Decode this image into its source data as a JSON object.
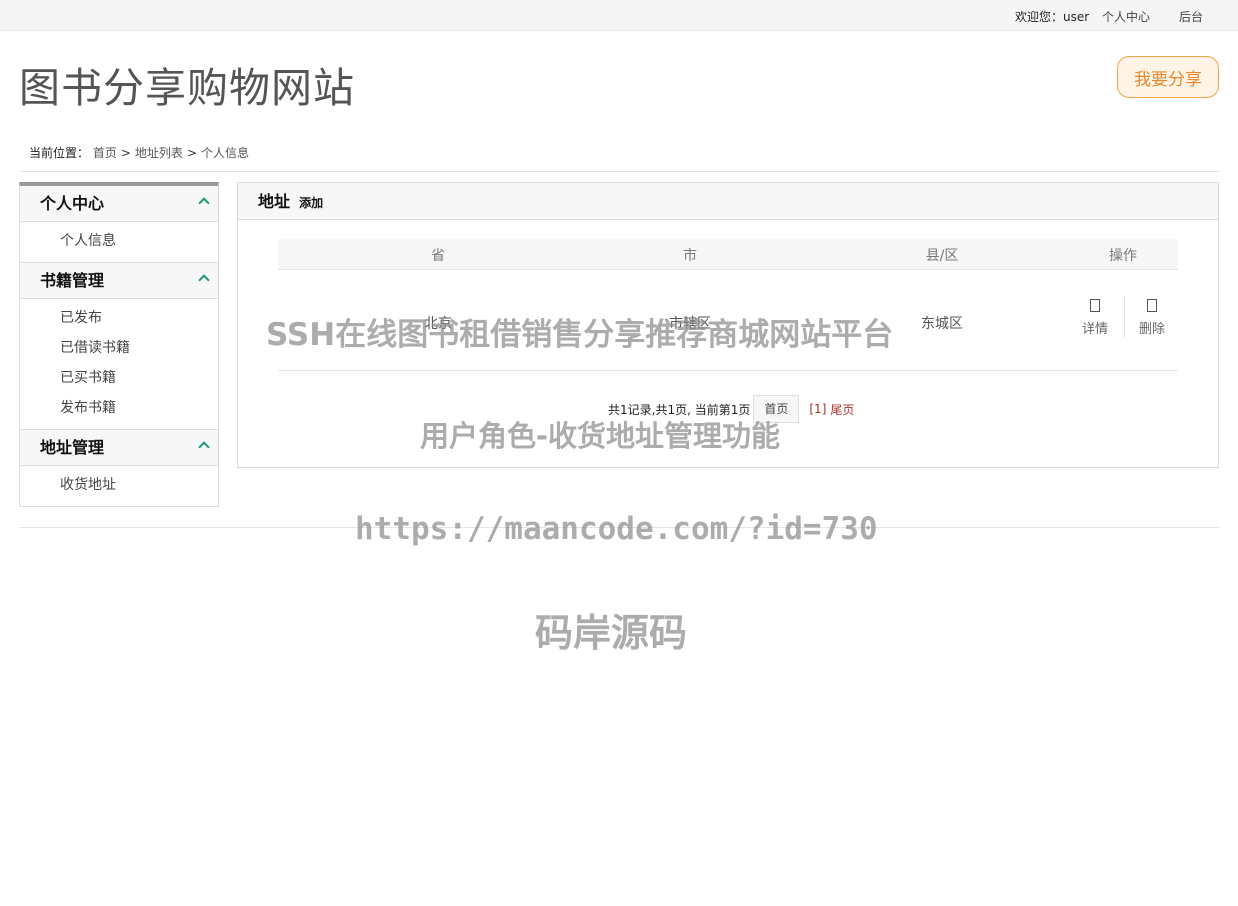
{
  "topbar": {
    "welcome": "欢迎您：user",
    "personal_center": "个人中心",
    "admin": "后台"
  },
  "header": {
    "site_title": "图书分享购物网站",
    "share_button": "我要分享"
  },
  "breadcrumb": {
    "label": "当前位置：",
    "items": [
      "首页",
      "地址列表",
      "个人信息"
    ],
    "separator": ">"
  },
  "sidebar": {
    "sections": [
      {
        "title": "个人中心",
        "items": [
          "个人信息"
        ]
      },
      {
        "title": "书籍管理",
        "items": [
          "已发布",
          "已借读书籍",
          "已买书籍",
          "发布书籍"
        ]
      },
      {
        "title": "地址管理",
        "items": [
          "收货地址"
        ]
      }
    ]
  },
  "main": {
    "title": "地址",
    "add_link": "添加",
    "table": {
      "columns": [
        "省",
        "市",
        "县/区",
        "操作"
      ],
      "rows": [
        {
          "province": "北京",
          "city": "市辖区",
          "district": "东城区",
          "actions": [
            "详情",
            "删除"
          ]
        }
      ]
    },
    "pagination": {
      "summary": "共1记录,共1页, 当前第1页",
      "first": "首页",
      "current": "[1]",
      "last": "尾页"
    }
  },
  "watermarks": {
    "line1": "SSH在线图书租借销售分享推荐商城网站平台",
    "line2": "用户角色-收货地址管理功能",
    "line3": "https://maancode.com/?id=730",
    "line4": "码岸源码"
  },
  "colors": {
    "accent_orange": "#e8892c",
    "chevron_green": "#1a9a7a",
    "page_red": "#b03030"
  }
}
